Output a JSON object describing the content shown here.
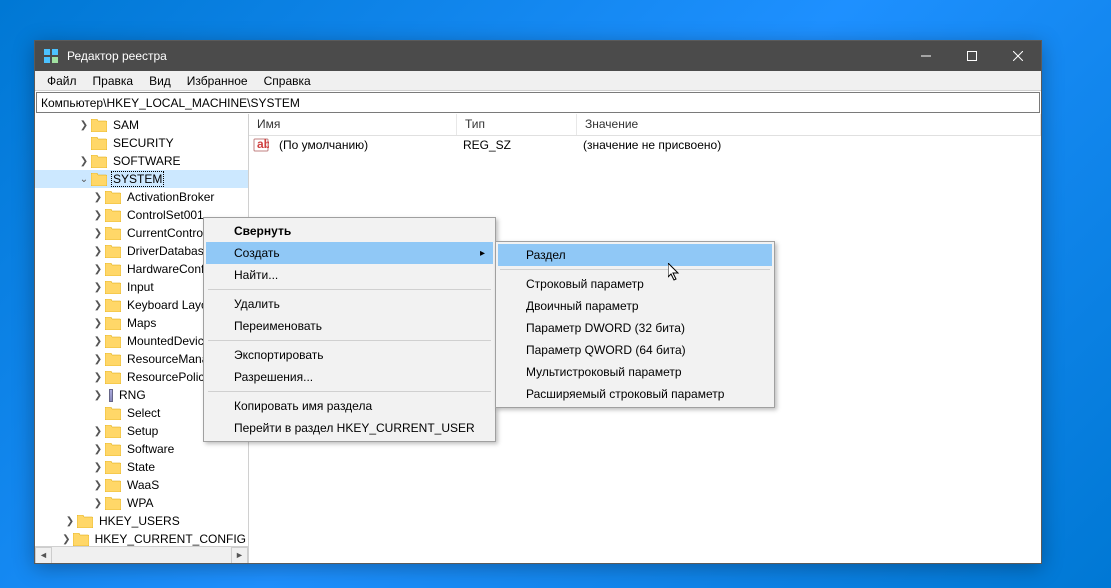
{
  "window": {
    "title": "Редактор реестра"
  },
  "menubar": [
    "Файл",
    "Правка",
    "Вид",
    "Избранное",
    "Справка"
  ],
  "address": "Компьютер\\HKEY_LOCAL_MACHINE\\SYSTEM",
  "tree": [
    {
      "indent": 3,
      "toggle": ">",
      "label": "SAM"
    },
    {
      "indent": 3,
      "toggle": "",
      "label": "SECURITY"
    },
    {
      "indent": 3,
      "toggle": ">",
      "label": "SOFTWARE"
    },
    {
      "indent": 3,
      "toggle": "v",
      "label": "SYSTEM",
      "selected": true
    },
    {
      "indent": 4,
      "toggle": ">",
      "label": "ActivationBroker"
    },
    {
      "indent": 4,
      "toggle": ">",
      "label": "ControlSet001"
    },
    {
      "indent": 4,
      "toggle": ">",
      "label": "CurrentControlSet"
    },
    {
      "indent": 4,
      "toggle": ">",
      "label": "DriverDatabase"
    },
    {
      "indent": 4,
      "toggle": ">",
      "label": "HardwareConfig"
    },
    {
      "indent": 4,
      "toggle": ">",
      "label": "Input"
    },
    {
      "indent": 4,
      "toggle": ">",
      "label": "Keyboard Layout"
    },
    {
      "indent": 4,
      "toggle": ">",
      "label": "Maps"
    },
    {
      "indent": 4,
      "toggle": ">",
      "label": "MountedDevices"
    },
    {
      "indent": 4,
      "toggle": ">",
      "label": "ResourceManager"
    },
    {
      "indent": 4,
      "toggle": ">",
      "label": "ResourcePolicyStore"
    },
    {
      "indent": 4,
      "toggle": ">",
      "label": "RNG",
      "barIcon": true
    },
    {
      "indent": 4,
      "toggle": "",
      "label": "Select"
    },
    {
      "indent": 4,
      "toggle": ">",
      "label": "Setup"
    },
    {
      "indent": 4,
      "toggle": ">",
      "label": "Software"
    },
    {
      "indent": 4,
      "toggle": ">",
      "label": "State"
    },
    {
      "indent": 4,
      "toggle": ">",
      "label": "WaaS"
    },
    {
      "indent": 4,
      "toggle": ">",
      "label": "WPA"
    },
    {
      "indent": 2,
      "toggle": ">",
      "label": "HKEY_USERS"
    },
    {
      "indent": 2,
      "toggle": ">",
      "label": "HKEY_CURRENT_CONFIG"
    }
  ],
  "list": {
    "headers": {
      "name": "Имя",
      "type": "Тип",
      "value": "Значение"
    },
    "rows": [
      {
        "name": "(По умолчанию)",
        "type": "REG_SZ",
        "value": "(значение не присвоено)"
      }
    ]
  },
  "context": {
    "items": [
      {
        "label": "Свернуть",
        "bold": true
      },
      {
        "label": "Создать",
        "submenu": true,
        "hover": true
      },
      {
        "label": "Найти..."
      },
      {
        "sep": true
      },
      {
        "label": "Удалить"
      },
      {
        "label": "Переименовать"
      },
      {
        "sep": true
      },
      {
        "label": "Экспортировать"
      },
      {
        "label": "Разрешения..."
      },
      {
        "sep": true
      },
      {
        "label": "Копировать имя раздела"
      },
      {
        "label": "Перейти в раздел HKEY_CURRENT_USER"
      }
    ],
    "submenu": [
      {
        "label": "Раздел",
        "hover": true
      },
      {
        "sep": true
      },
      {
        "label": "Строковый параметр"
      },
      {
        "label": "Двоичный параметр"
      },
      {
        "label": "Параметр DWORD (32 бита)"
      },
      {
        "label": "Параметр QWORD (64 бита)"
      },
      {
        "label": "Мультистроковый параметр"
      },
      {
        "label": "Расширяемый строковый параметр"
      }
    ]
  }
}
